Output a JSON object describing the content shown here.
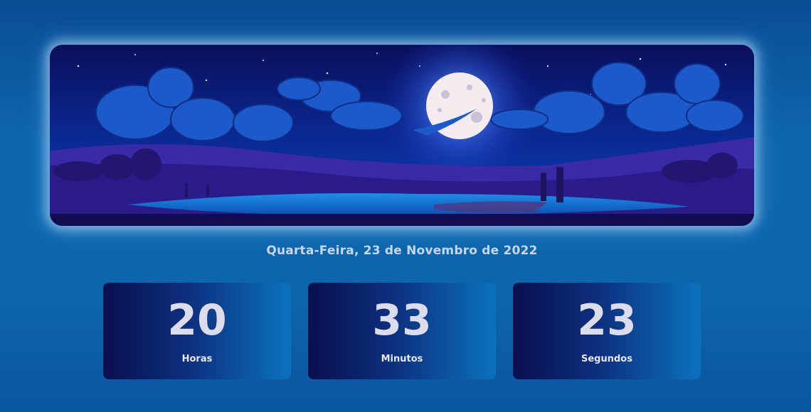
{
  "banner": {
    "image": "night-lake-full-moon-illustration"
  },
  "date_text": "Quarta-Feira, 23 de Novembro de 2022",
  "clock": [
    {
      "value": "20",
      "label": "Horas"
    },
    {
      "value": "33",
      "label": "Minutos"
    },
    {
      "value": "23",
      "label": "Segundos"
    }
  ],
  "colors": {
    "background": "#0e67ad",
    "card_start": "#0a0f4e",
    "card_end": "#0b72bd",
    "text": "#dcdcec"
  }
}
